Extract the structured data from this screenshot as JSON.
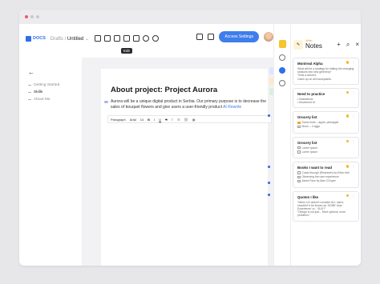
{
  "app": {
    "logo_text": "DOCS"
  },
  "breadcrumb": {
    "folder": "Drafts",
    "separator": "/",
    "doc": "Untitled"
  },
  "tooltip": {
    "text": "Edit"
  },
  "toolbar": {
    "access_label": "Access Settings"
  },
  "nav": {
    "items": [
      {
        "label": "Getting Started",
        "active": false
      },
      {
        "label": "Skills",
        "active": true
      },
      {
        "label": "About Me",
        "active": false
      }
    ]
  },
  "document": {
    "title": "About project: Project Aurora",
    "body": "Aurora will be a unique digital product in Serbia. Our primary purpose is to decrease the sales of bouquet flowers and give users a user-friendly product",
    "ai_link": "AI Rewrite",
    "format_bar": {
      "paragraph": "Paragraph",
      "font": "Arial",
      "size": "14",
      "bold": "B",
      "italic": "I",
      "underline": "U",
      "strike": "S"
    }
  },
  "notes": {
    "header_small": "Writer",
    "title": "Notes",
    "cards": [
      {
        "title": "Montreal Alpha",
        "lines": [
          "What will be a strategy for halting the changing seasons into new greenery?",
          "Think a about it.",
          "Catch up on all housepaints."
        ]
      },
      {
        "title": "Need to practice",
        "lines": [
          "• Illustrations",
          "• Movement UI"
        ]
      },
      {
        "title": "Grocery list",
        "checks": [
          [
            "Some fruits – apple, pineapple",
            true
          ],
          [
            "Moon – 2 eggs",
            false
          ]
        ]
      },
      {
        "title": "Grocery list",
        "checks": [
          [
            "Lorem ipsum",
            false
          ],
          [
            "Lorem ipsum",
            false
          ]
        ]
      },
      {
        "title": "Books I want to read",
        "checks": [
          [
            "Crack through (Research) by Erika Hall",
            false
          ],
          [
            "Observing the user experience",
            false
          ],
          [
            "About Face by Alan COoper",
            false
          ]
        ]
      },
      {
        "title": "Quotes I like",
        "lines": [
          "\"When UX doesn't consider ALL users, shouldn't it be known as 'SOME User Experience' or... SUX?\"",
          "\"Design is not just... More options, more problems.\""
        ]
      }
    ]
  }
}
